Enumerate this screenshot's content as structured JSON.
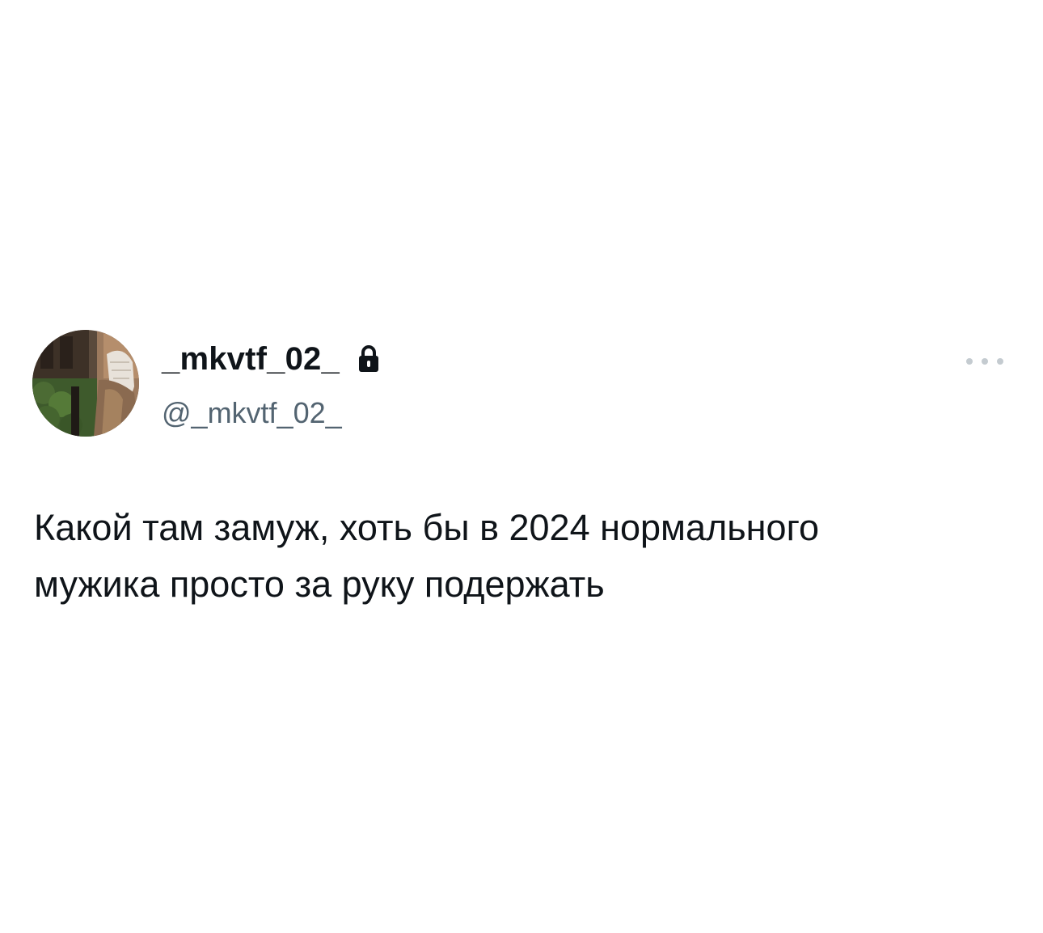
{
  "tweet": {
    "author": {
      "display_name": "_mkvtf_02_",
      "handle": "@_mkvtf_02_",
      "protected_icon": "lock-icon",
      "avatar_icon": "profile-photo"
    },
    "more_icon": "more-horizontal-icon",
    "text": "Какой там замуж, хоть бы в 2024 нормального\nмужика просто за руку подержать"
  },
  "colors": {
    "text_primary": "#0f1419",
    "text_secondary": "#536471",
    "background": "#ffffff"
  }
}
